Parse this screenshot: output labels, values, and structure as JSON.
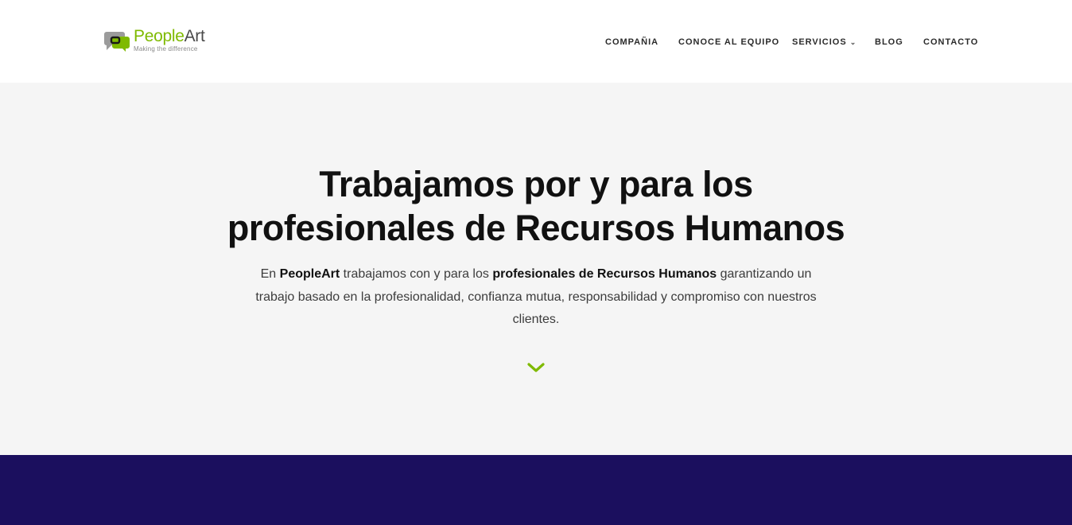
{
  "brand": {
    "name_part1": "People",
    "name_part2": "Art",
    "tagline": "Making the difference",
    "accent_color": "#7fba00",
    "icon": "speech-bubbles-logo-icon"
  },
  "nav": {
    "items": [
      {
        "label": "COMPAÑIA"
      },
      {
        "label": "CONOCE AL EQUIPO"
      },
      {
        "label": "SERVICIOS",
        "chevron": "⌄"
      },
      {
        "label": "BLOG"
      },
      {
        "label": "CONTACTO"
      }
    ]
  },
  "hero": {
    "headline_line1": "Trabajamos por y para los",
    "headline_line2": "profesionales de Recursos Humanos",
    "intro": {
      "t1": "En ",
      "b1": "PeopleArt",
      "t2": " trabajamos con y para los ",
      "b2": "profesionales de Recursos Humanos",
      "t3": " garantizando un trabajo basado en la profesionalidad, confianza mutua, responsabilidad y compromiso con nuestros clientes."
    },
    "scroll_icon": "chevron-down-icon",
    "background": "#f5f5f5"
  },
  "band": {
    "color": "#1b0f5e"
  }
}
